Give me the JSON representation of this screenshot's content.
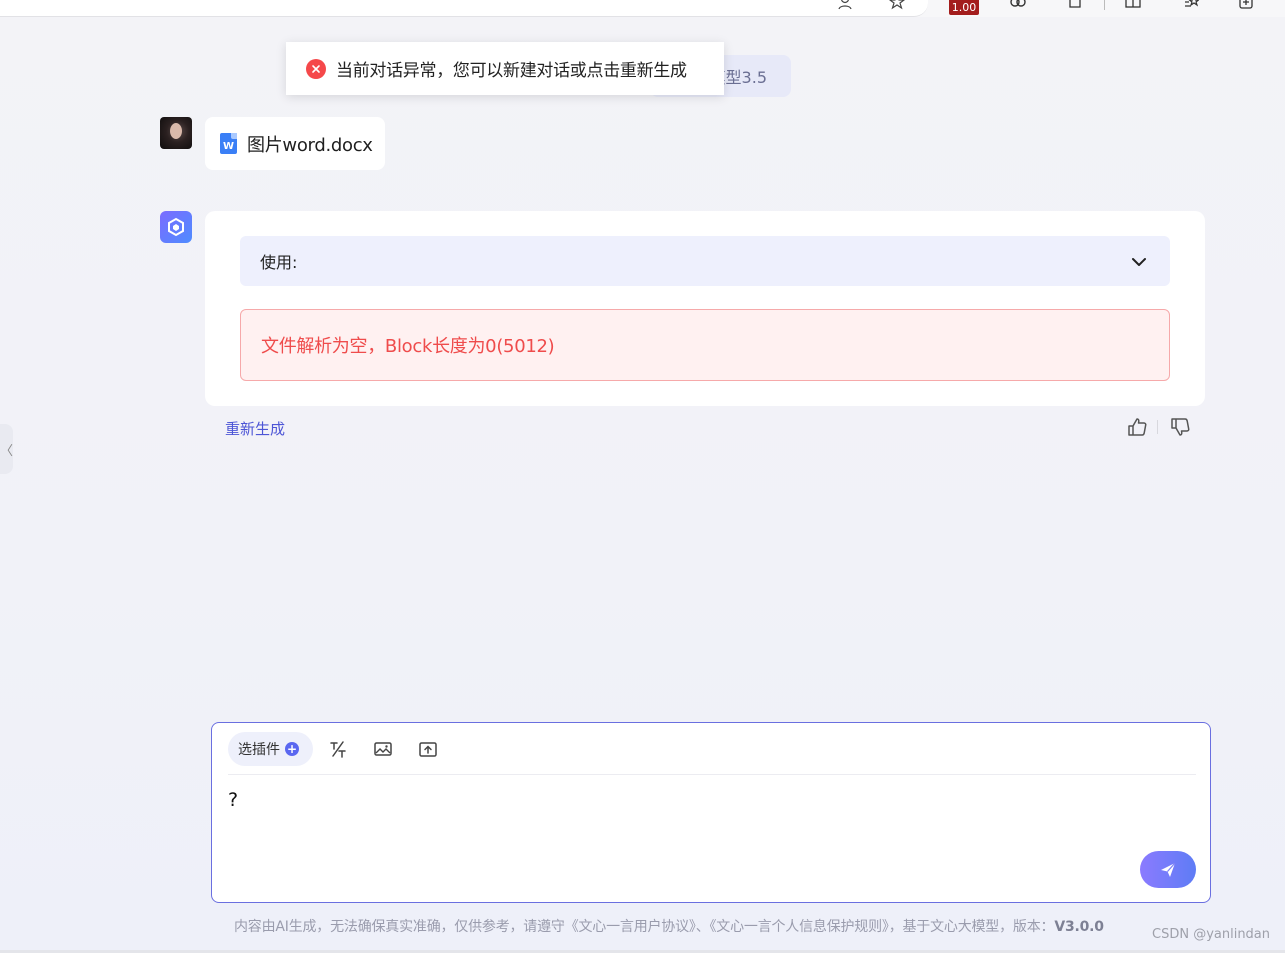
{
  "browser": {
    "zoom": "1.00"
  },
  "toast": {
    "message": "当前对话异常，您可以新建对话或点击重新生成"
  },
  "model_pill": {
    "label": "模型3.5"
  },
  "user_message": {
    "file_name": "图片word.docx",
    "file_icon_letter": "W"
  },
  "bot_message": {
    "plugin_label": "使用:",
    "error_text": "文件解析为空，Block长度为0(5012)",
    "regenerate_label": "重新生成"
  },
  "side_tab": {
    "glyph": "〈"
  },
  "composer": {
    "plugin_button_label": "选插件",
    "input_value": "?"
  },
  "footer": {
    "note": "内容由AI生成，无法确保真实准确，仅供参考，请遵守《文心一言用户协议》、《文心一言个人信息保护规则》，基于文心大模型，版本：",
    "version": "V3.0.0",
    "watermark": "CSDN @yanlindan"
  },
  "colors": {
    "accent": "#4d55d6",
    "error": "#ef4c4c",
    "error_bg": "#fff1f1",
    "toast_icon": "#f5484a"
  },
  "icons": [
    "person-icon",
    "bookmark-icon",
    "copilot-icon",
    "extensions-icon",
    "split-screen-icon",
    "favorites-icon",
    "collections-icon",
    "close-circle-icon",
    "word-file-icon",
    "bot-logo-icon",
    "chevron-down-icon",
    "thumbs-up-icon",
    "thumbs-down-icon",
    "plus-icon",
    "text-tool-icon",
    "image-icon",
    "upload-icon",
    "send-icon"
  ]
}
